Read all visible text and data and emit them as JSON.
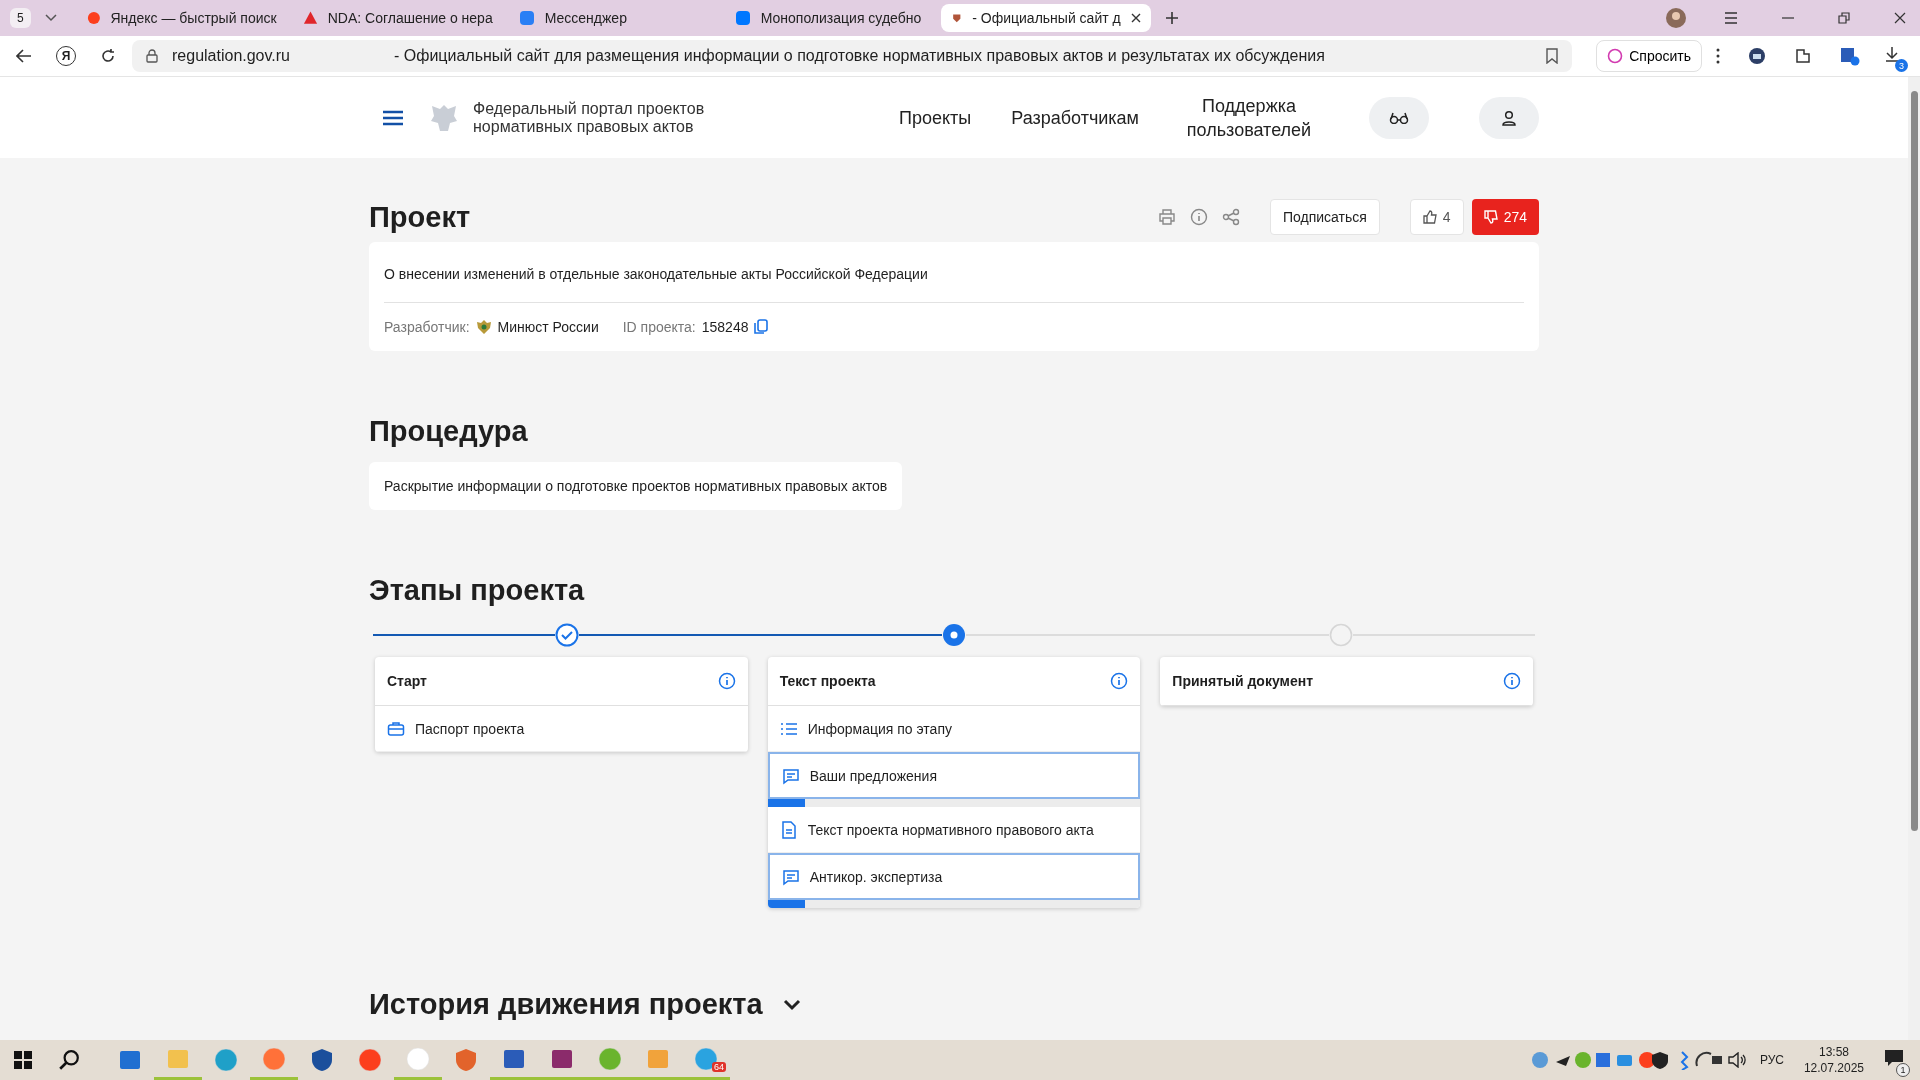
{
  "browser": {
    "tab_count": "5",
    "tabs": [
      {
        "title": "Яндекс — быстрый поиск",
        "kind": "yandex",
        "selected": false
      },
      {
        "title": "NDA: Соглашение о нера",
        "kind": "warning",
        "selected": false
      },
      {
        "title": "Мессенджер",
        "kind": "chat",
        "selected": false
      },
      {
        "title": "Монополизация судебно",
        "kind": "vk",
        "selected": false
      },
      {
        "title": "- Официальный сайт д",
        "kind": "emblem",
        "selected": true
      }
    ],
    "address_bar": {
      "browser_logo": "Я",
      "url": "regulation.gov.ru",
      "page_title": "- Официальный сайт для размещения информации о подготовке нормативных правовых актов и результатах их обсуждения"
    },
    "ask_button": "Спросить",
    "downloads_badge": "3"
  },
  "header": {
    "portal_name": "Федеральный портал проектов нормативных правовых актов",
    "nav": [
      "Проекты",
      "Разработчикам",
      "Поддержка пользователей"
    ]
  },
  "project": {
    "title": "Проект",
    "subscribe": "Подписаться",
    "likes": "4",
    "dislikes": "274",
    "description": "О внесении изменений в отдельные законодательные акты Российской Федерации",
    "developer_label": "Разработчик:",
    "developer": "Минюст России",
    "id_label": "ID проекта:",
    "id": "158248"
  },
  "procedure": {
    "title": "Процедура",
    "text": "Раскрытие информации о подготовке проектов нормативных правовых актов"
  },
  "stages": {
    "title": "Этапы проекта",
    "items": [
      {
        "name": "Старт",
        "completed": true,
        "selected": false,
        "links": [
          {
            "kind": "briefcase",
            "label": "Паспорт проекта"
          }
        ]
      },
      {
        "name": "Текст проекта",
        "completed": false,
        "selected": true,
        "links": [
          {
            "kind": "list",
            "label": "Информация по этапу"
          },
          {
            "kind": "comment",
            "label": "Ваши предложения",
            "level": 0.1
          },
          {
            "kind": "document",
            "label": "Текст проекта нормативного правового акта"
          },
          {
            "kind": "comment",
            "label": "Антикор. экспертиза",
            "level": 0.1
          }
        ]
      },
      {
        "name": "Принятый документ",
        "completed": false,
        "selected": false
      }
    ]
  },
  "history": {
    "title": "История движения проекта"
  },
  "taskbar": {
    "apps": [
      {
        "kind": "store",
        "running": false
      },
      {
        "kind": "folder",
        "running": true
      },
      {
        "kind": "edge",
        "running": false
      },
      {
        "kind": "firefox",
        "running": true
      },
      {
        "kind": "shield",
        "running": false
      },
      {
        "kind": "yandex",
        "running": false
      },
      {
        "kind": "ybrowser",
        "running": true
      },
      {
        "kind": "badge",
        "running": false
      },
      {
        "kind": "word",
        "running": true
      },
      {
        "kind": "archive",
        "running": true
      },
      {
        "kind": "torrent",
        "running": true
      },
      {
        "kind": "player",
        "running": true
      },
      {
        "kind": "telegram",
        "running": true,
        "badge": "64"
      }
    ],
    "language": "РУС",
    "time": "13:58",
    "date": "12.07.2025",
    "notifications": "1"
  }
}
